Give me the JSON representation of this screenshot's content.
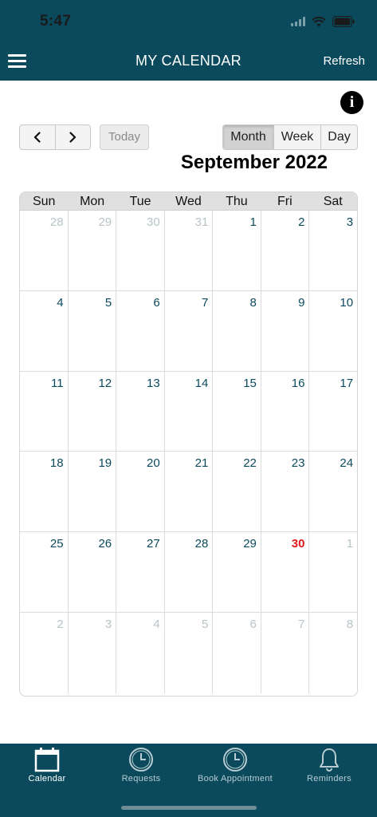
{
  "status": {
    "time": "5:47"
  },
  "header": {
    "title": "MY CALENDAR",
    "refresh_label": "Refresh"
  },
  "toolbar": {
    "today_label": "Today",
    "views": [
      "Month",
      "Week",
      "Day"
    ],
    "active_view": "Month"
  },
  "calendar": {
    "month_title": "September 2022",
    "weekdays": [
      "Sun",
      "Mon",
      "Tue",
      "Wed",
      "Thu",
      "Fri",
      "Sat"
    ],
    "weeks": [
      [
        {
          "d": "28",
          "cur": false
        },
        {
          "d": "29",
          "cur": false
        },
        {
          "d": "30",
          "cur": false
        },
        {
          "d": "31",
          "cur": false
        },
        {
          "d": "1",
          "cur": true
        },
        {
          "d": "2",
          "cur": true
        },
        {
          "d": "3",
          "cur": true
        }
      ],
      [
        {
          "d": "4",
          "cur": true
        },
        {
          "d": "5",
          "cur": true
        },
        {
          "d": "6",
          "cur": true
        },
        {
          "d": "7",
          "cur": true
        },
        {
          "d": "8",
          "cur": true
        },
        {
          "d": "9",
          "cur": true
        },
        {
          "d": "10",
          "cur": true
        }
      ],
      [
        {
          "d": "11",
          "cur": true
        },
        {
          "d": "12",
          "cur": true
        },
        {
          "d": "13",
          "cur": true
        },
        {
          "d": "14",
          "cur": true
        },
        {
          "d": "15",
          "cur": true
        },
        {
          "d": "16",
          "cur": true
        },
        {
          "d": "17",
          "cur": true
        }
      ],
      [
        {
          "d": "18",
          "cur": true
        },
        {
          "d": "19",
          "cur": true
        },
        {
          "d": "20",
          "cur": true
        },
        {
          "d": "21",
          "cur": true
        },
        {
          "d": "22",
          "cur": true
        },
        {
          "d": "23",
          "cur": true
        },
        {
          "d": "24",
          "cur": true
        }
      ],
      [
        {
          "d": "25",
          "cur": true
        },
        {
          "d": "26",
          "cur": true
        },
        {
          "d": "27",
          "cur": true
        },
        {
          "d": "28",
          "cur": true
        },
        {
          "d": "29",
          "cur": true
        },
        {
          "d": "30",
          "cur": true,
          "today": true
        },
        {
          "d": "1",
          "cur": false
        }
      ],
      [
        {
          "d": "2",
          "cur": false
        },
        {
          "d": "3",
          "cur": false
        },
        {
          "d": "4",
          "cur": false
        },
        {
          "d": "5",
          "cur": false
        },
        {
          "d": "6",
          "cur": false
        },
        {
          "d": "7",
          "cur": false
        },
        {
          "d": "8",
          "cur": false
        }
      ]
    ]
  },
  "tabs": [
    {
      "label": "Calendar",
      "icon": "calendar-icon",
      "active": true
    },
    {
      "label": "Requests",
      "icon": "clock-icon",
      "active": false
    },
    {
      "label": "Book Appointment",
      "icon": "clock-icon",
      "active": false
    },
    {
      "label": "Reminders",
      "icon": "bell-icon",
      "active": false
    }
  ],
  "colors": {
    "primary": "#0b4a5c",
    "today_highlight": "#e0191c",
    "other_month_text": "#b8c4c8"
  }
}
